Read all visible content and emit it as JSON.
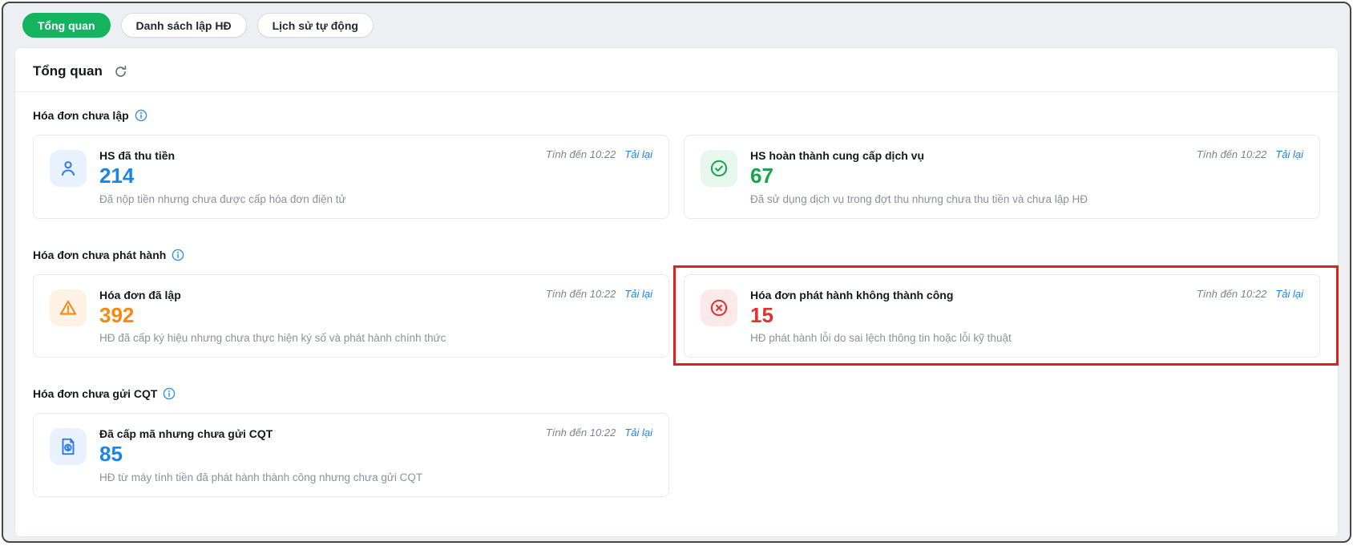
{
  "colors": {
    "active_tab_green": "#13b35f",
    "value_blue": "#1a84ee",
    "value_green": "#16a64d",
    "value_orange": "#f6890e",
    "value_red": "#e0322e",
    "highlight_border_red": "#e0201c",
    "info_icon_blue": "#3390ec"
  },
  "tabs": [
    {
      "label": "Tổng quan",
      "active": true
    },
    {
      "label": "Danh sách lập HĐ",
      "active": false
    },
    {
      "label": "Lịch sử tự động",
      "active": false
    }
  ],
  "panel": {
    "title": "Tổng quan"
  },
  "sections": [
    {
      "heading": "Hóa đơn chưa lập",
      "cards": [
        {
          "icon": "user-icon",
          "title": "HS đã thu tiền",
          "value": "214",
          "value_color": "#1a84ee",
          "desc": "Đã nộp tiền nhưng chưa được cấp hóa đơn điện tử",
          "as_of": "Tính đến 10:22",
          "reload_label": "Tải lại"
        },
        {
          "icon": "check-circle-icon",
          "title": "HS hoàn thành cung cấp dịch vụ",
          "value": "67",
          "value_color": "#16a64d",
          "desc": "Đã sử dụng dịch vụ trong đợt thu nhưng chưa thu tiền và chưa lập HĐ",
          "as_of": "Tính đến 10:22",
          "reload_label": "Tải lại"
        }
      ]
    },
    {
      "heading": "Hóa đơn chưa phát hành",
      "cards": [
        {
          "icon": "warning-triangle-icon",
          "title": "Hóa đơn đã lập",
          "value": "392",
          "value_color": "#f6890e",
          "desc": "HĐ đã cấp ký hiệu nhưng chưa thực hiện ký số và phát hành chính thức",
          "as_of": "Tính đến 10:22",
          "reload_label": "Tải lại"
        },
        {
          "icon": "x-circle-icon",
          "title": "Hóa đơn phát hành không thành công",
          "value": "15",
          "value_color": "#e0322e",
          "desc": "HĐ phát hành lỗi do sai lệch thông tin hoặc lỗi kỹ thuật",
          "as_of": "Tính đến 10:22",
          "reload_label": "Tải lại",
          "highlighted": true
        }
      ]
    },
    {
      "heading": "Hóa đơn chưa gửi CQT",
      "cards": [
        {
          "icon": "invoice-dollar-icon",
          "title": "Đã cấp mã nhưng chưa gửi CQT",
          "value": "85",
          "value_color": "#1a84ee",
          "desc": "HĐ từ máy tính tiền đã phát hành thành công nhưng chưa gửi CQT",
          "as_of": "Tính đến 10:22",
          "reload_label": "Tải lại"
        }
      ]
    }
  ]
}
